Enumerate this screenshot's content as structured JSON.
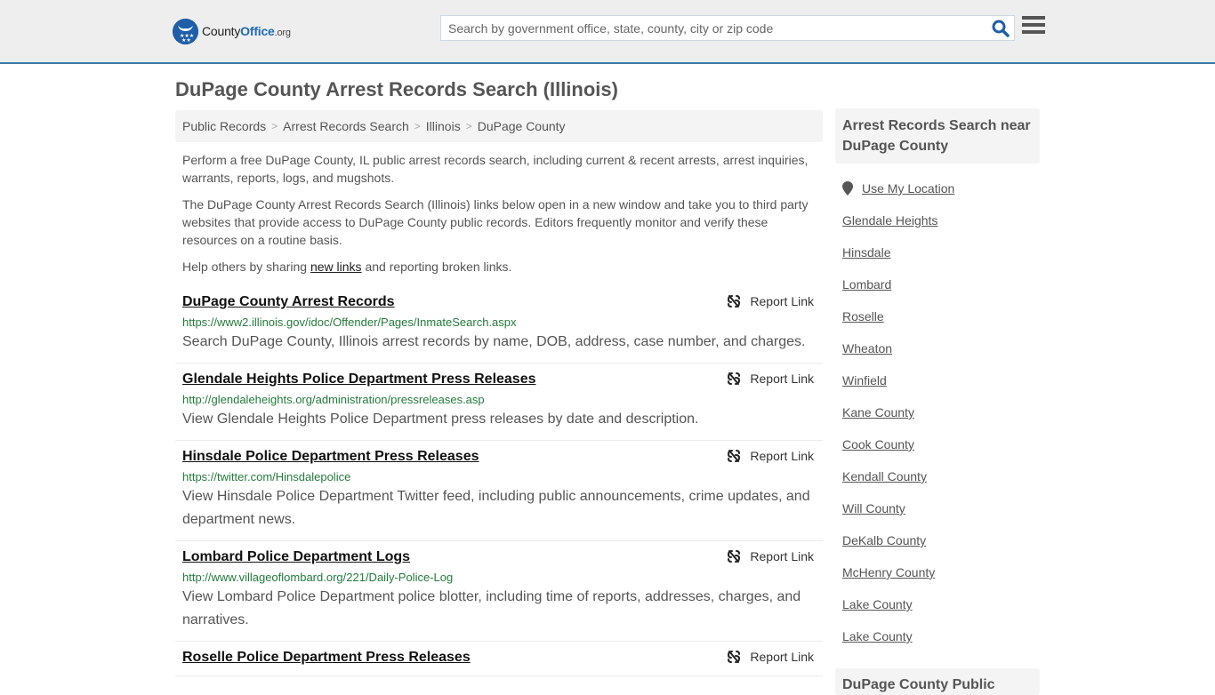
{
  "header": {
    "logo": {
      "part1": "County",
      "part2": "Office",
      "part3": ".org"
    },
    "search_placeholder": "Search by government office, state, county, city or zip code",
    "search_value": "",
    "accent_color": "#3f78a8"
  },
  "page": {
    "title": "DuPage County Arrest Records Search (Illinois)"
  },
  "breadcrumb": [
    {
      "label": "Public Records"
    },
    {
      "label": "Arrest Records Search"
    },
    {
      "label": "Illinois"
    },
    {
      "label": "DuPage County"
    }
  ],
  "intro": {
    "p1": "Perform a free DuPage County, IL public arrest records search, including current & recent arrests, arrest inquiries, warrants, reports, logs, and mugshots.",
    "p2": "The DuPage County Arrest Records Search (Illinois) links below open in a new window and take you to third party websites that provide access to DuPage County public records. Editors frequently monitor and verify these resources on a routine basis.",
    "p3_before": "Help others by sharing ",
    "p3_link": "new links",
    "p3_after": " and reporting broken links."
  },
  "results": [
    {
      "title": "DuPage County Arrest Records",
      "url": "https://www2.illinois.gov/idoc/Offender/Pages/InmateSearch.aspx",
      "description": "Search DuPage County, Illinois arrest records by name, DOB, address, case number, and charges.",
      "report_label": "Report Link"
    },
    {
      "title": "Glendale Heights Police Department Press Releases",
      "url": "http://glendaleheights.org/administration/pressreleases.asp",
      "description": "View Glendale Heights Police Department press releases by date and description.",
      "report_label": "Report Link"
    },
    {
      "title": "Hinsdale Police Department Press Releases",
      "url": "https://twitter.com/Hinsdalepolice",
      "description": "View Hinsdale Police Department Twitter feed, including public announcements, crime updates, and department news.",
      "report_label": "Report Link"
    },
    {
      "title": "Lombard Police Department Logs",
      "url": "http://www.villageoflombard.org/221/Daily-Police-Log",
      "description": "View Lombard Police Department police blotter, including time of reports, addresses, charges, and narratives.",
      "report_label": "Report Link"
    },
    {
      "title": "Roselle Police Department Press Releases",
      "url": "",
      "description": "",
      "report_label": "Report Link"
    }
  ],
  "sidebar": {
    "heading": "Arrest Records Search near DuPage County",
    "use_location": "Use My Location",
    "items": [
      {
        "label": "Glendale Heights"
      },
      {
        "label": "Hinsdale"
      },
      {
        "label": "Lombard"
      },
      {
        "label": "Roselle"
      },
      {
        "label": "Wheaton"
      },
      {
        "label": "Winfield"
      },
      {
        "label": "Kane County"
      },
      {
        "label": "Cook County"
      },
      {
        "label": "Kendall County"
      },
      {
        "label": "Will County"
      },
      {
        "label": "DeKalb County"
      },
      {
        "label": "McHenry County"
      },
      {
        "label": "Lake County"
      },
      {
        "label": "Lake County"
      }
    ],
    "heading2": "DuPage County Public"
  }
}
